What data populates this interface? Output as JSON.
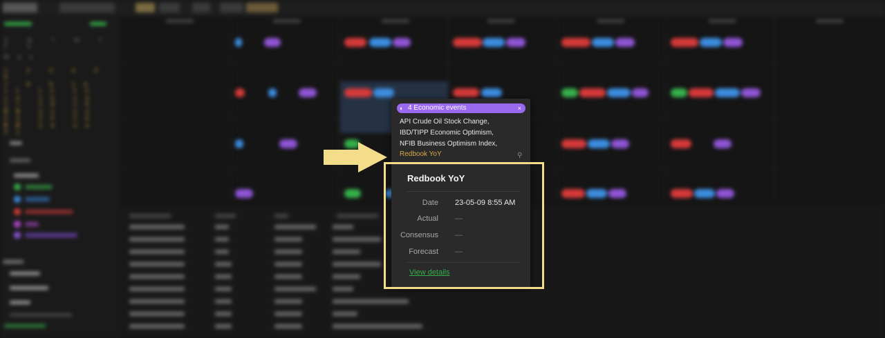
{
  "popup": {
    "header_icon": "calendar-icon",
    "header_title": "4 Economic events",
    "close_glyph": "×",
    "events": [
      "API Crude Oil Stock Change,",
      "IBD/TIPP Economic Optimism,",
      "NFIB Business Optimism Index,",
      "Redbook YoY"
    ],
    "detail": {
      "title": "Redbook YoY",
      "fields": [
        {
          "label": "Date",
          "value": "23-05-09 8:55 AM"
        },
        {
          "label": "Actual",
          "value": "—"
        },
        {
          "label": "Consensus",
          "value": "—"
        },
        {
          "label": "Forecast",
          "value": "—"
        }
      ],
      "view_details": "View details"
    }
  },
  "colors": {
    "header_purple": "#9b68f0",
    "highlight_yellow": "#f3dc8a",
    "event_highlight": "#d9a948",
    "link_green": "#36b04a"
  }
}
